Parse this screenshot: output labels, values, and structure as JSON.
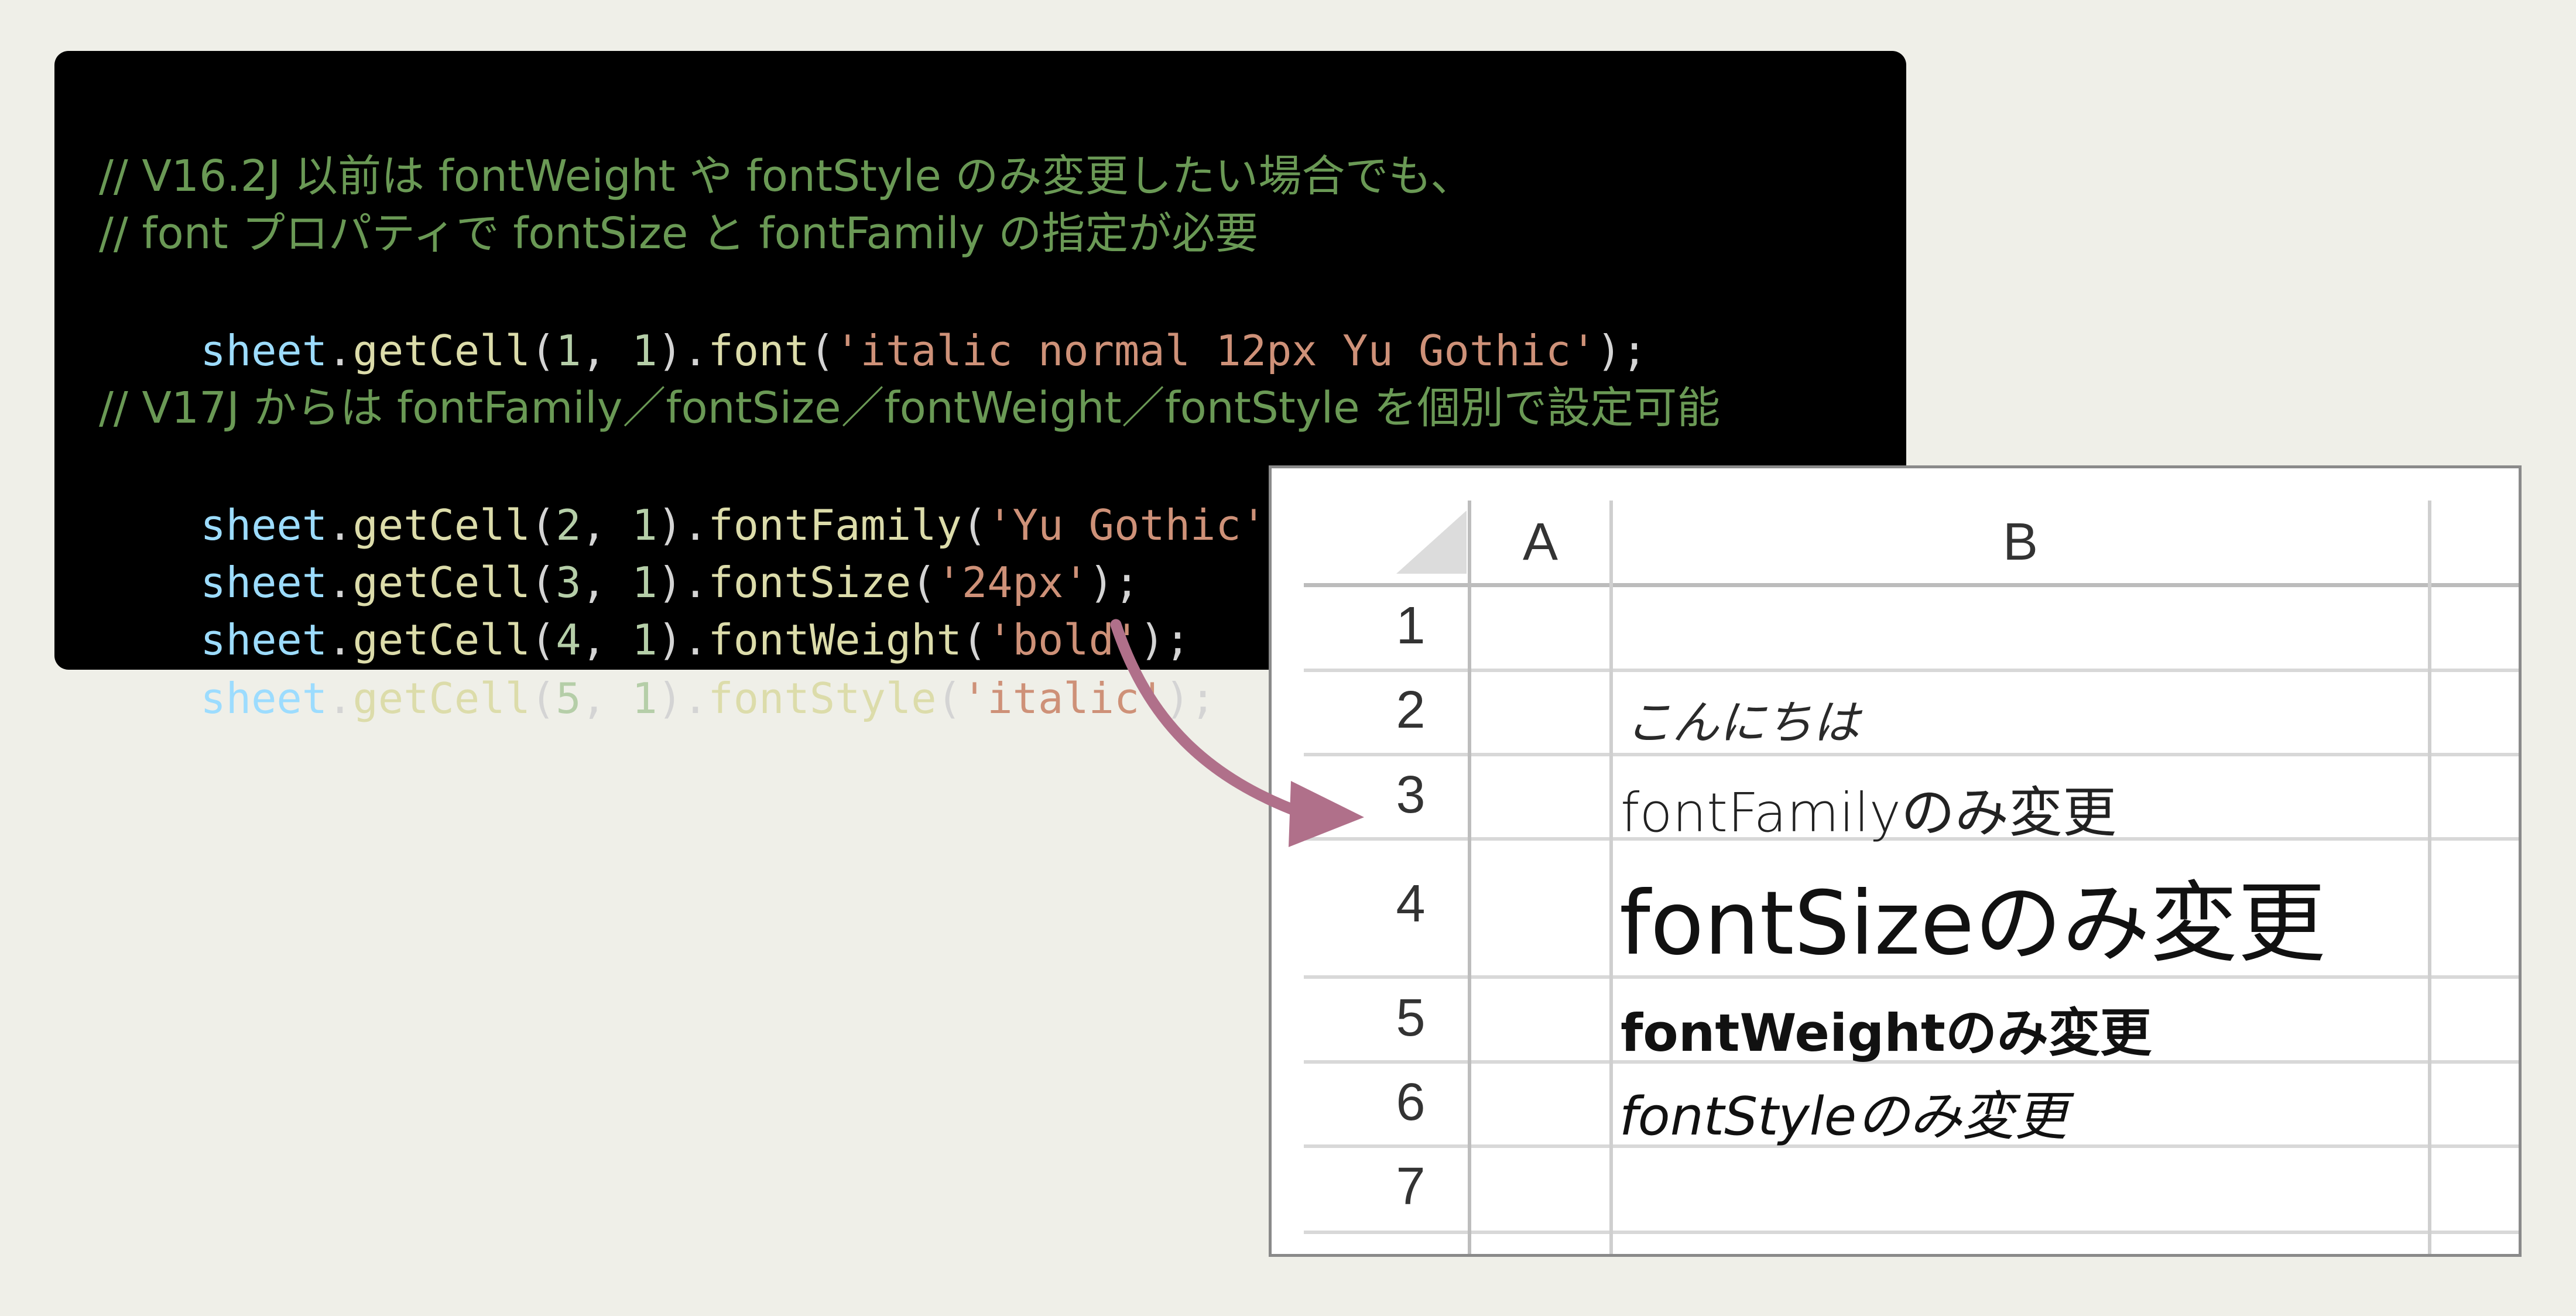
{
  "code": {
    "comment_1": "// V16.2J 以前は fontWeight や fontStyle のみ変更したい場合でも、",
    "comment_2": "// font プロパティで fontSize と fontFamily の指定が必要",
    "line_1": {
      "var": "sheet",
      "p1": ".",
      "fn1": "getCell",
      "p2": "(",
      "n1": "1",
      "p3": ", ",
      "n2": "1",
      "p4": ").",
      "fn2": "font",
      "p5": "(",
      "str": "'italic normal 12px Yu Gothic'",
      "p6": ");"
    },
    "comment_3": "// V17J からは fontFamily／fontSize／fontWeight／fontStyle を個別で設定可能",
    "line_2": {
      "var": "sheet",
      "p1": ".",
      "fn1": "getCell",
      "p2": "(",
      "n1": "2",
      "p3": ", ",
      "n2": "1",
      "p4": ").",
      "fn2": "fontFamily",
      "p5": "(",
      "str": "'Yu Gothic'",
      "p6": ");"
    },
    "line_3": {
      "var": "sheet",
      "p1": ".",
      "fn1": "getCell",
      "p2": "(",
      "n1": "3",
      "p3": ", ",
      "n2": "1",
      "p4": ").",
      "fn2": "fontSize",
      "p5": "(",
      "str": "'24px'",
      "p6": ");"
    },
    "line_4": {
      "var": "sheet",
      "p1": ".",
      "fn1": "getCell",
      "p2": "(",
      "n1": "4",
      "p3": ", ",
      "n2": "1",
      "p4": ").",
      "fn2": "fontWeight",
      "p5": "(",
      "str": "'bold'",
      "p6": ");"
    },
    "line_5": {
      "var": "sheet",
      "p1": ".",
      "fn1": "getCell",
      "p2": "(",
      "n1": "5",
      "p3": ", ",
      "n2": "1",
      "p4": ").",
      "fn2": "fontStyle",
      "p5": "(",
      "str": "'italic'",
      "p6": ");"
    }
  },
  "sheet": {
    "columns": [
      "A",
      "B"
    ],
    "rows": [
      "1",
      "2",
      "3",
      "4",
      "5",
      "6",
      "7"
    ],
    "cells": {
      "r2": "こんにちは",
      "r3": "fontFamilyのみ変更",
      "r4": "fontSizeのみ変更",
      "r5": "fontWeightのみ変更",
      "r6": "fontStyleのみ変更"
    }
  },
  "colors": {
    "background": "#efefe8",
    "code_background": "#000000",
    "comment": "#6a9955",
    "variable": "#9cdcfe",
    "function": "#dcdcaa",
    "number": "#b5cea8",
    "string": "#ce9178",
    "arrow": "#b0708a"
  }
}
